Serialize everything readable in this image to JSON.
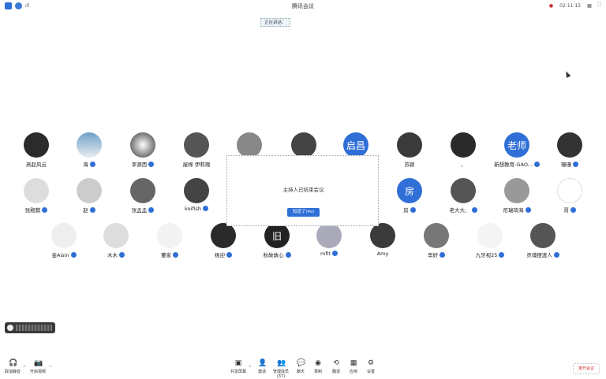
{
  "window": {
    "title": "腾讯会议",
    "time": "02:11:15",
    "speaker_chip": "正在讲话："
  },
  "participants_row1": [
    {
      "name": "燕赵风云",
      "mic": false,
      "avatar": "photo"
    },
    {
      "name": "海",
      "mic": true,
      "avatar": "photo"
    },
    {
      "name": "李源西",
      "mic": true,
      "avatar": "photo"
    },
    {
      "name": "屋棉 伊莉瑰",
      "mic": false,
      "avatar": "photo"
    },
    {
      "name": "",
      "mic": false,
      "avatar": "photo"
    },
    {
      "name": "",
      "mic": false,
      "avatar": "photo"
    },
    {
      "name": "",
      "mic": false,
      "avatar": "text",
      "avatar_text": "启昌",
      "color": "#2f6fd6"
    },
    {
      "name": "苏颖",
      "mic": false,
      "avatar": "photo"
    },
    {
      "name": "、",
      "mic": false,
      "avatar": "dark"
    },
    {
      "name": "新想教育-GAO...",
      "mic": true,
      "avatar": "text",
      "avatar_text": "老师",
      "color": "#2f6fd6"
    },
    {
      "name": "珊珊",
      "mic": true,
      "avatar": "photo"
    }
  ],
  "participants_row2": [
    {
      "name": "张殿麒",
      "mic": true
    },
    {
      "name": "赵",
      "mic": true
    },
    {
      "name": "张孟孟",
      "mic": true
    },
    {
      "name": "koifish",
      "mic": true
    },
    {
      "name": "房",
      "mic": true,
      "avatar_text": "房",
      "color": "#2f6fd6"
    },
    {
      "name": "老大大、",
      "mic": true
    },
    {
      "name": "尼瑞琦海",
      "mic": true
    },
    {
      "name": "哥",
      "mic": true
    }
  ],
  "participants_row3": [
    {
      "name": "金Aisin",
      "mic": true
    },
    {
      "name": "木木",
      "mic": true
    },
    {
      "name": "董家",
      "mic": true
    },
    {
      "name": "杨迎",
      "mic": true
    },
    {
      "name": "秋故故心",
      "mic": true,
      "avatar_text": "旧",
      "color": "#222222"
    },
    {
      "name": "mfit",
      "mic": true
    },
    {
      "name": "Amy",
      "mic": false
    },
    {
      "name": "早好",
      "mic": true
    },
    {
      "name": "九牙视25",
      "mic": true
    },
    {
      "name": "灵魂摆渡人",
      "mic": true
    }
  ],
  "dialog": {
    "message": "主持人已结束会议",
    "button": "知道了(4s)"
  },
  "toolbar": {
    "left": [
      {
        "label": "取消静音",
        "icon": "headset-icon"
      },
      {
        "label": "开启视频",
        "icon": "camera-icon"
      }
    ],
    "center": [
      {
        "label": "共享屏幕",
        "icon": "share-screen-icon"
      },
      {
        "label": "邀请",
        "icon": "invite-icon"
      },
      {
        "label": "管理成员(37)",
        "icon": "members-icon"
      },
      {
        "label": "聊天",
        "icon": "chat-icon"
      },
      {
        "label": "录制",
        "icon": "record-icon"
      },
      {
        "label": "翻译",
        "icon": "translate-icon"
      },
      {
        "label": "应用",
        "icon": "apps-icon"
      },
      {
        "label": "设置",
        "icon": "settings-icon"
      }
    ],
    "end_label": "离开会议"
  },
  "colors": {
    "accent": "#2f6fd6",
    "mic": "#2f6fd6"
  }
}
